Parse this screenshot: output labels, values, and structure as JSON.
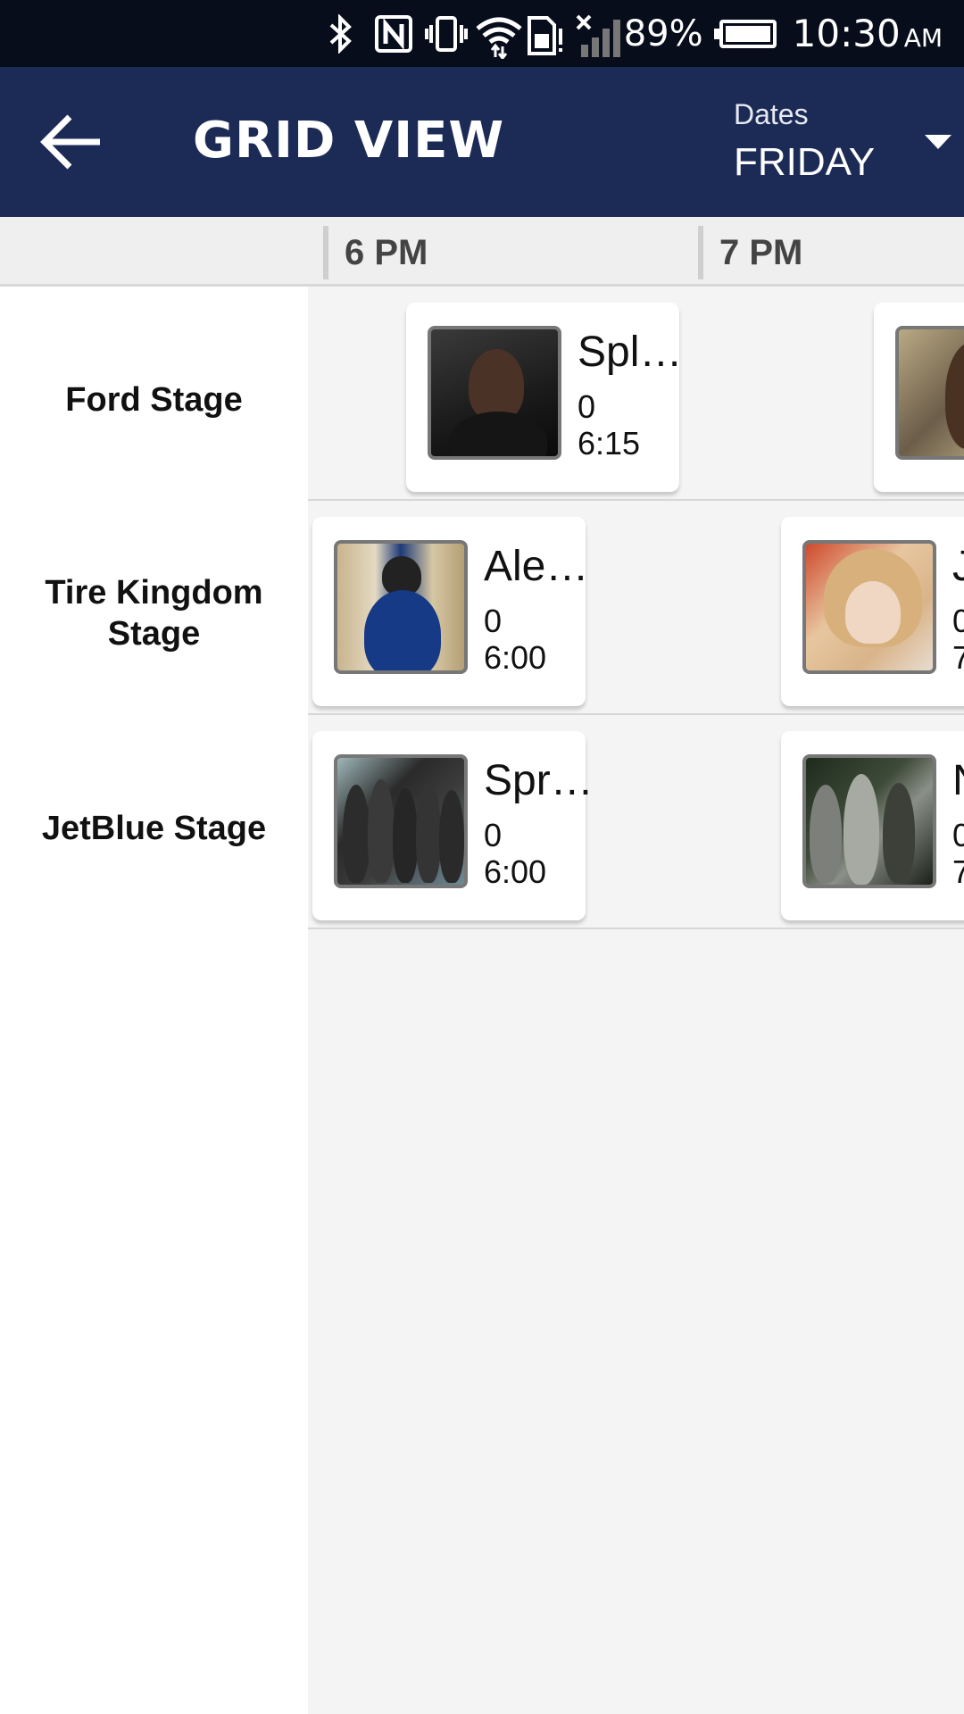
{
  "status_bar": {
    "battery": "89%",
    "time": "10:30",
    "ampm": "AM"
  },
  "app_bar": {
    "title": "GRID VIEW",
    "dates_label": "Dates",
    "dates_value": "FRIDAY"
  },
  "time_header": {
    "slots": [
      "6 PM",
      "7 PM"
    ]
  },
  "stages": [
    "Ford Stage",
    "Tire Kingdom Stage",
    "JetBlue Stage"
  ],
  "grid": {
    "rows": [
      {
        "cards": [
          {
            "title": "Spl…",
            "count": "0",
            "time": "6:15"
          },
          {
            "title": "",
            "count": "",
            "time": ""
          }
        ]
      },
      {
        "cards": [
          {
            "title": "Ale…",
            "count": "0",
            "time": "6:00"
          },
          {
            "title": "J",
            "count": "0",
            "time": "7"
          }
        ]
      },
      {
        "cards": [
          {
            "title": "Spr…",
            "count": "0",
            "time": "6:00"
          },
          {
            "title": "N",
            "count": "0",
            "time": "7"
          }
        ]
      }
    ]
  }
}
